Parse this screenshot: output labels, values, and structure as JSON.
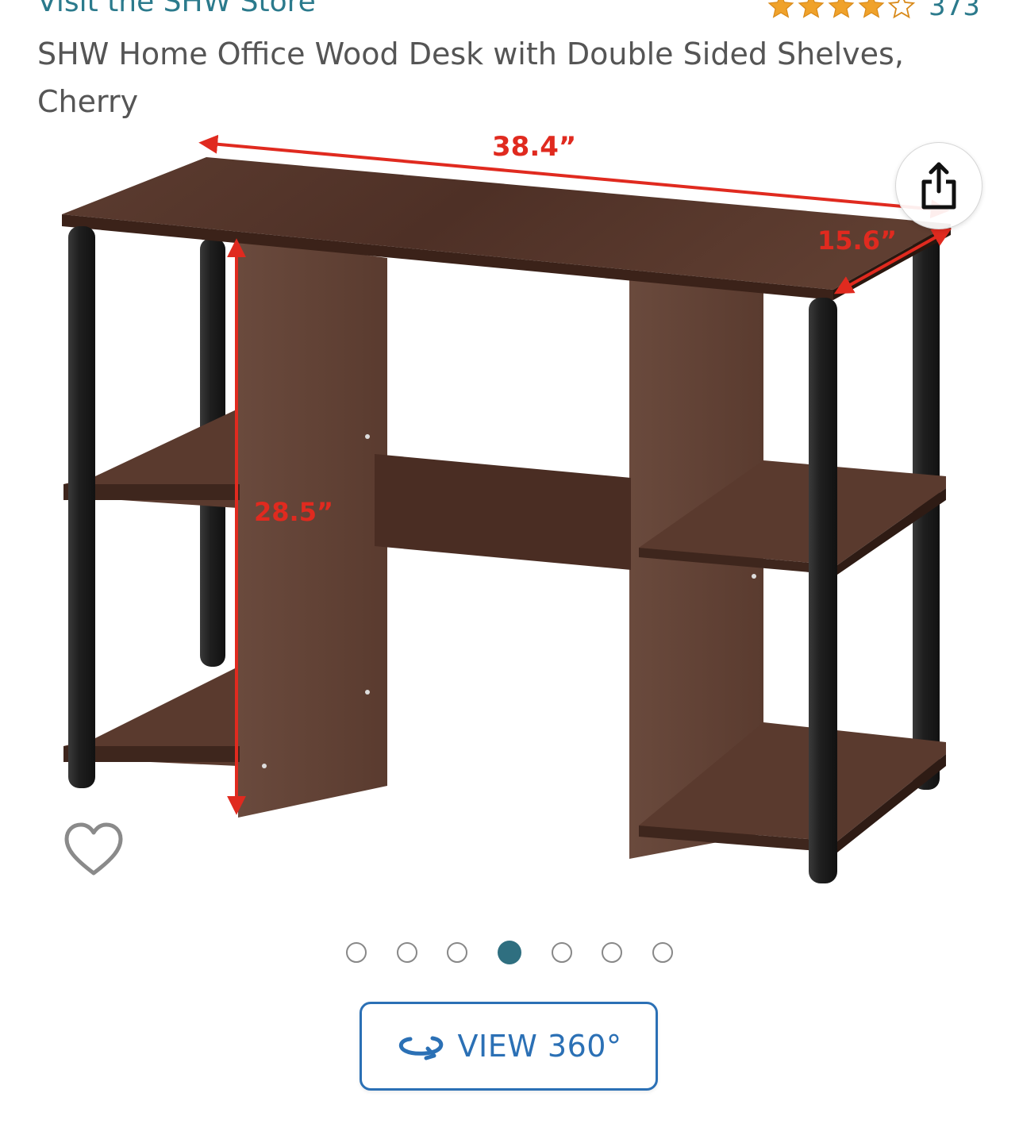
{
  "store_link": "Visit the SHW Store",
  "rating": {
    "stars": 4.5,
    "review_count": "373",
    "star_color": "#f0a22a"
  },
  "product": {
    "title": "SHW Home Office Wood Desk with Double Sided Shelves, Cherry",
    "dimensions": {
      "width": "38.4”",
      "depth": "15.6”",
      "height": "28.5”"
    }
  },
  "icons": {
    "share": "share-icon",
    "wishlist": "heart-icon",
    "rotate": "rotate-360-icon"
  },
  "carousel": {
    "total": 7,
    "active_index": 3
  },
  "view360": {
    "label": "VIEW 360°"
  },
  "colors": {
    "link": "#2b7a8c",
    "accent": "#2b70b5",
    "dimension_marker": "#e02a1f",
    "wood": "#5a3a2e"
  }
}
